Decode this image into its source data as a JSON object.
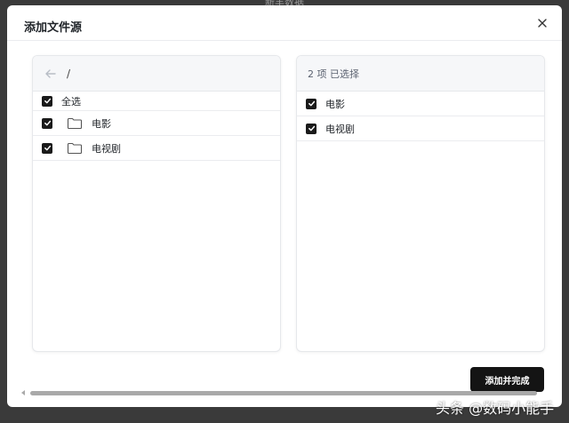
{
  "backdrop": {
    "title": "新丰数据"
  },
  "dialog": {
    "title": "添加文件源",
    "close_symbol": "×",
    "submit_label": "添加并完成"
  },
  "left_panel": {
    "path": "/",
    "select_all_label": "全选",
    "items": [
      {
        "name": "电影",
        "checked": true,
        "icon": "folder-icon"
      },
      {
        "name": "电视剧",
        "checked": true,
        "icon": "folder-icon"
      }
    ]
  },
  "right_panel": {
    "selected_count_text": "2 项 已选择",
    "items": [
      {
        "name": "电影",
        "checked": true
      },
      {
        "name": "电视剧",
        "checked": true
      }
    ]
  },
  "watermark": {
    "text": "头条 @数码小能手"
  },
  "colors": {
    "primary": "#141414",
    "panel_header": "#f6f7f9",
    "border": "#e6e8eb"
  }
}
